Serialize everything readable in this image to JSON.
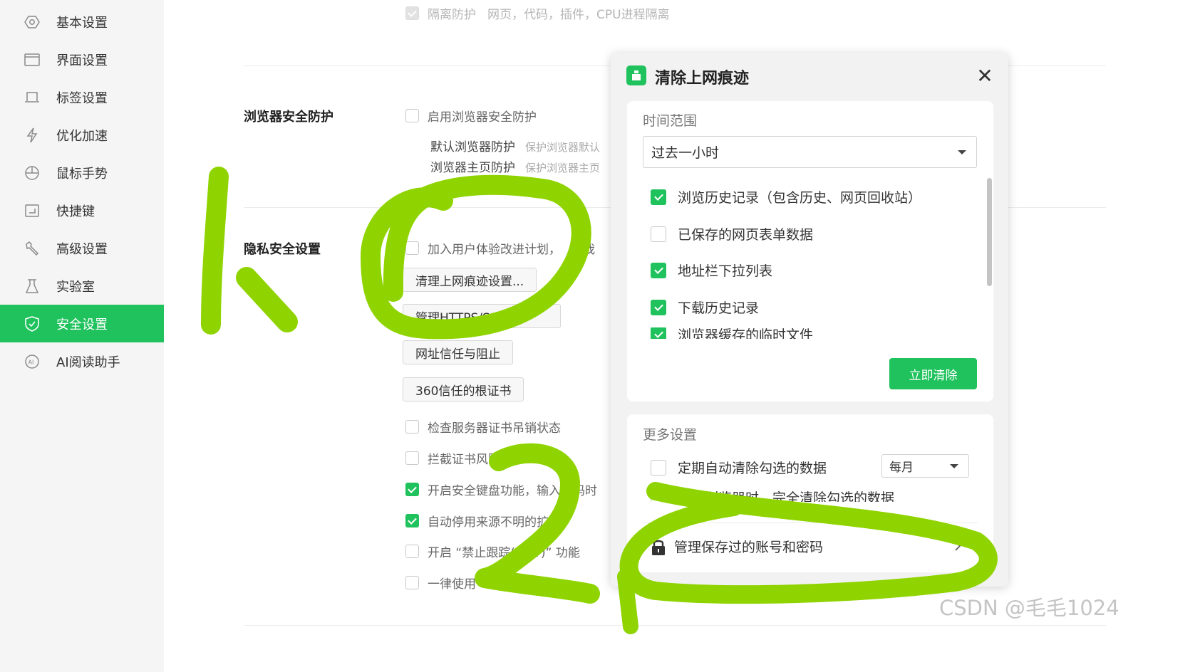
{
  "sidebar": {
    "items": [
      {
        "label": "基本设置",
        "icon": "gear-icon"
      },
      {
        "label": "界面设置",
        "icon": "window-icon"
      },
      {
        "label": "标签设置",
        "icon": "tab-icon"
      },
      {
        "label": "优化加速",
        "icon": "lightning-icon"
      },
      {
        "label": "鼠标手势",
        "icon": "mouse-icon"
      },
      {
        "label": "快捷键",
        "icon": "keyboard-shortcut-icon"
      },
      {
        "label": "高级设置",
        "icon": "wrench-icon"
      },
      {
        "label": "实验室",
        "icon": "flask-icon"
      },
      {
        "label": "安全设置",
        "icon": "shield-icon",
        "active": true
      },
      {
        "label": "AI阅读助手",
        "icon": "ai-icon"
      }
    ]
  },
  "main": {
    "top_option": {
      "label": "隔离防护",
      "desc": "网页，代码，插件，CPU进程隔离",
      "checked": true,
      "disabled": true
    },
    "browser_security": {
      "title": "浏览器安全防护",
      "enable_label": "启用浏览器安全防护",
      "sub1_label": "默认浏览器防护",
      "sub1_desc": "保护浏览器默认",
      "sub2_label": "浏览器主页防护",
      "sub2_desc": "保护浏览器主页"
    },
    "privacy": {
      "title": "隐私安全设置",
      "ux_plan_label": "加入用户体验改进计划，",
      "ux_plan_tail": "动我",
      "buttons": [
        "清理上网痕迹设置...",
        "管理HTTPS/SSL...",
        "网址信任与阻止",
        "360信任的根证书"
      ],
      "options": [
        {
          "label": "检查服务器证书吊销状态",
          "checked": false
        },
        {
          "label": "拦截证书风险",
          "checked": false
        },
        {
          "label": "开启安全键盘功能，输入密码时",
          "checked": true
        },
        {
          "label": "自动停用来源不明的扩",
          "checked": true
        },
        {
          "label": "开启 “禁止跟踪(DNT)” 功能",
          "checked": false
        },
        {
          "label": "一律使用",
          "checked": false
        }
      ]
    }
  },
  "dialog": {
    "title": "清除上网痕迹",
    "close": "✕",
    "time_range_label": "时间范围",
    "time_range_value": "过去一小时",
    "items": [
      {
        "label": "浏览历史记录（包含历史、网页回收站）",
        "checked": true
      },
      {
        "label": "已保存的网页表单数据",
        "checked": false
      },
      {
        "label": "地址栏下拉列表",
        "checked": true
      },
      {
        "label": "下载历史记录",
        "checked": true
      },
      {
        "label": "浏览器缓存的临时文件",
        "checked": true
      }
    ],
    "clear_button": "立即清除",
    "more_settings_label": "更多设置",
    "auto_clear_label": "定期自动清除勾选的数据",
    "auto_clear_freq": "每月",
    "exit_clear_label": "退出浏览器时，完全清除勾选的数据",
    "manage_label": "管理保存过的账号和密码"
  },
  "watermark": "CSDN @毛毛1024",
  "annotation_color": "#8fd400"
}
